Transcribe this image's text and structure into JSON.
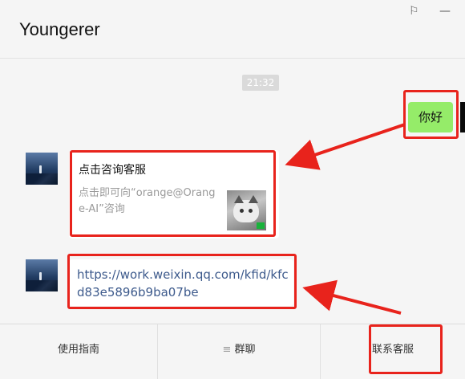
{
  "header": {
    "title": "Youngerer",
    "pin_glyph": "⚐",
    "minimize_glyph": "—"
  },
  "chat": {
    "timestamp": "21:32",
    "outgoing_message": "你好",
    "card": {
      "title": "点击咨询客服",
      "description": "点击即可向“orange@Orange-AI”咨询"
    },
    "link": "https://work.weixin.qq.com/kfid/kfcd83e5896b9ba07be"
  },
  "bottom_bar": {
    "items": [
      {
        "label": "使用指南"
      },
      {
        "label": "群聊",
        "icon": "menu-icon",
        "icon_glyph": "≡"
      },
      {
        "label": "联系客服"
      }
    ]
  },
  "annotation_color": "#e8231c",
  "bubble_color": "#95ec69",
  "link_color": "#3d5a8c"
}
